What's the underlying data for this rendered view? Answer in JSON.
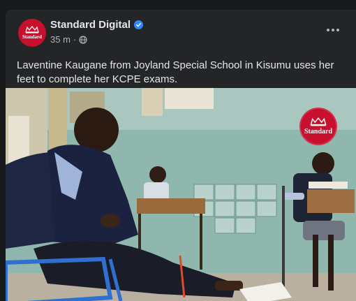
{
  "post": {
    "page_name": "Standard Digital",
    "avatar_brand": "Standard",
    "timestamp": "35 m",
    "separator": "·",
    "audience_icon": "globe-icon",
    "verified_icon": "verified-badge-icon",
    "more_icon": "more-options-icon",
    "caption": "Laventine Kaugane from Joyland Special School in Kisumu uses her feet to complete her KCPE exams.",
    "media": {
      "watermark_brand": "Standard"
    }
  },
  "colors": {
    "background": "#18191a",
    "card": "#242526",
    "brand_red": "#c8102e",
    "verified_blue": "#2d88ff",
    "text_primary": "#e4e6eb",
    "text_secondary": "#b0b3b8"
  }
}
